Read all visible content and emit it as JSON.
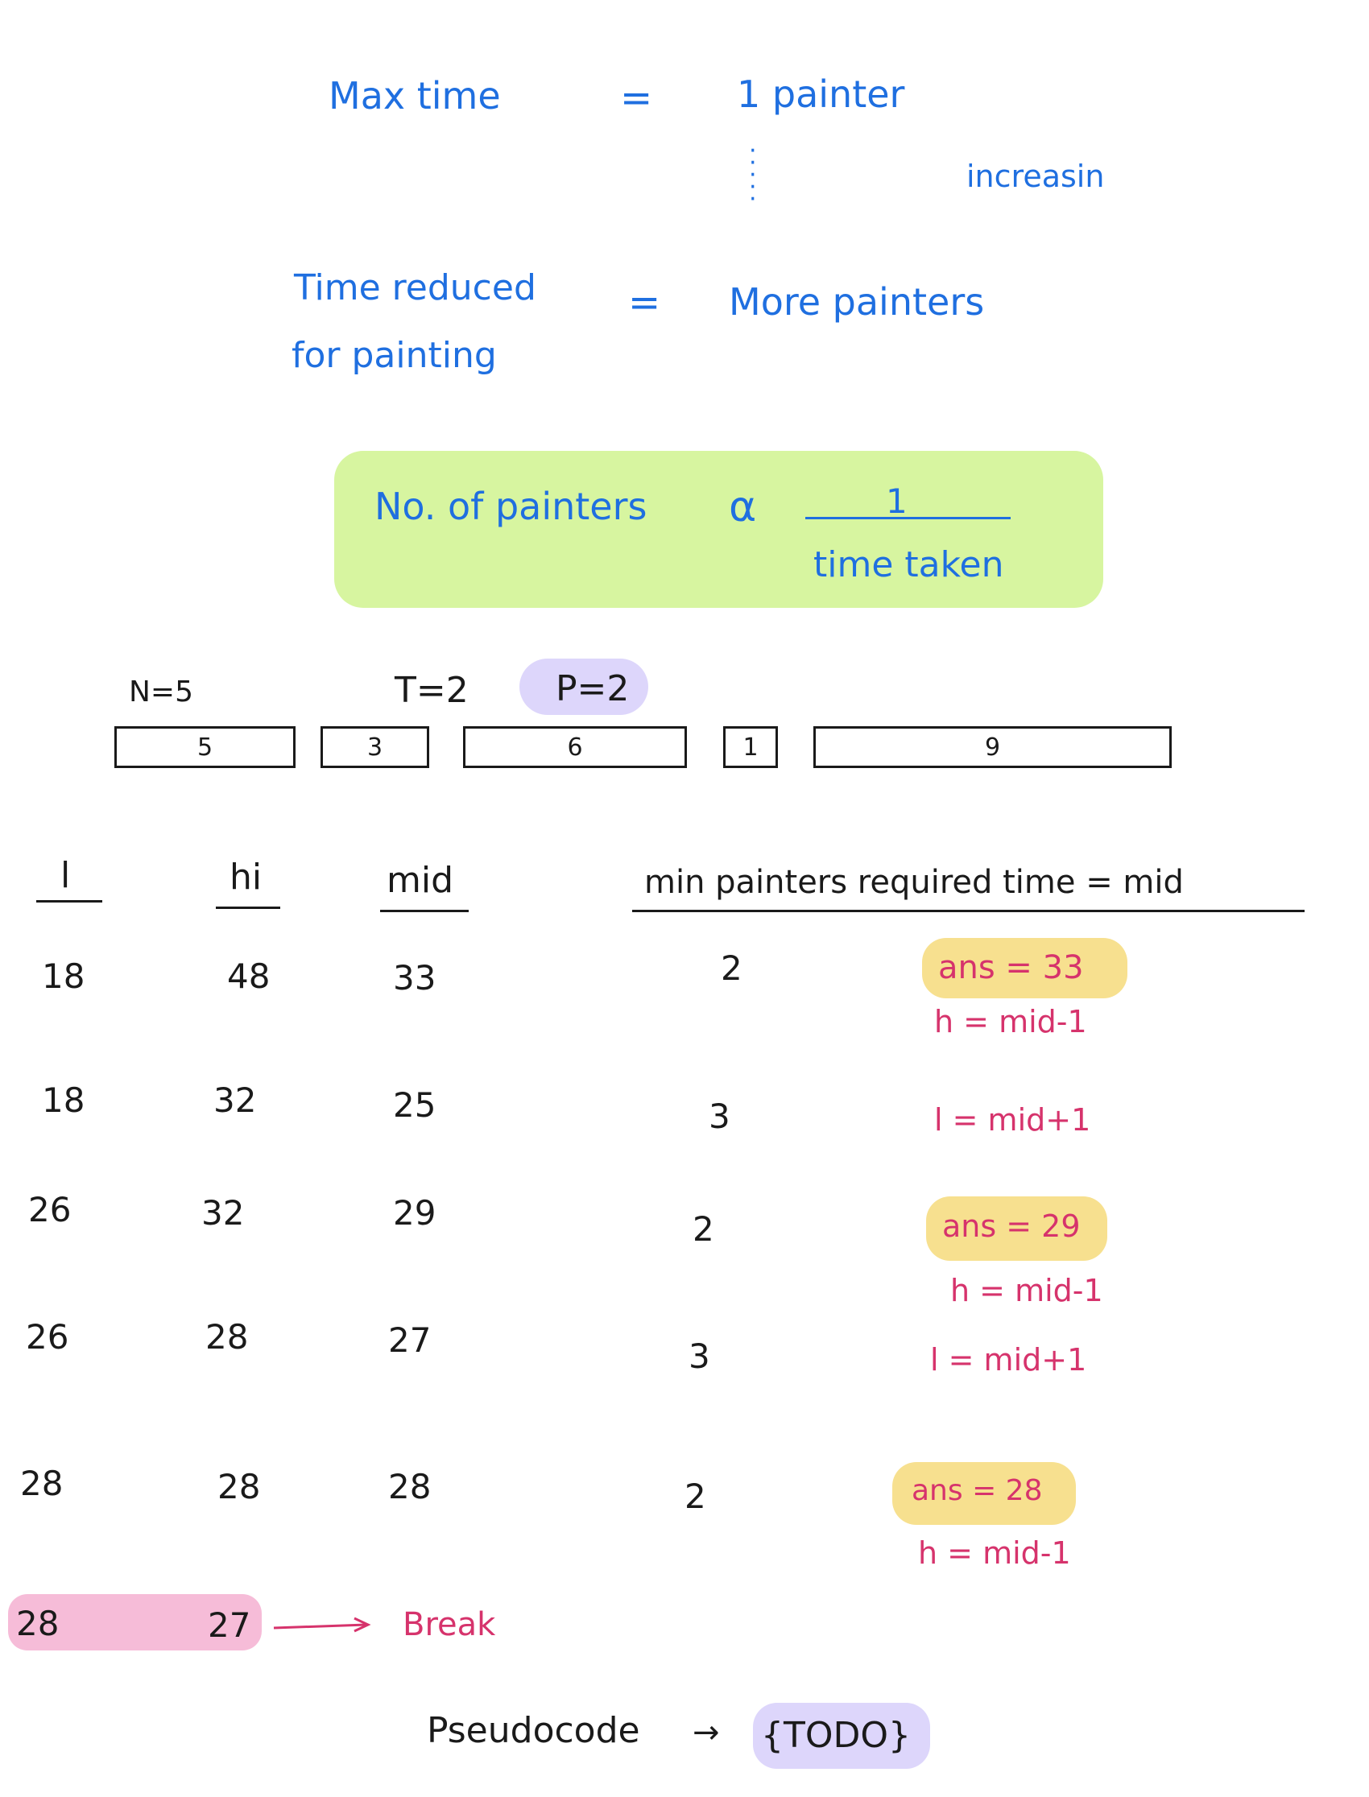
{
  "top": {
    "max_time": "Max time",
    "eq1": "=",
    "one_painter": "1 painter",
    "increasing": "increasin",
    "time_reduced": "Time reduced",
    "for_painting": "for painting",
    "eq2": "=",
    "more_painters": "More painters"
  },
  "formula": {
    "lhs": "No. of painters",
    "prop": "α",
    "numerator": "1",
    "denominator": "time taken"
  },
  "params": {
    "n": "N=5",
    "t": "T=2",
    "p": "P=2"
  },
  "boards": [
    "5",
    "3",
    "6",
    "1",
    "9"
  ],
  "table": {
    "headers": {
      "l": "l",
      "hi": "hi",
      "mid": "mid",
      "min_painters": "min painters required time = mid"
    },
    "rows": [
      {
        "l": "18",
        "hi": "48",
        "mid": "33",
        "p": "2",
        "note1": "ans = 33",
        "note2": "h = mid-1"
      },
      {
        "l": "18",
        "hi": "32",
        "mid": "25",
        "p": "3",
        "note1": "",
        "note2": "l = mid+1"
      },
      {
        "l": "26",
        "hi": "32",
        "mid": "29",
        "p": "2",
        "note1": "ans = 29",
        "note2": "h = mid-1"
      },
      {
        "l": "26",
        "hi": "28",
        "mid": "27",
        "p": "3",
        "note1": "",
        "note2": "l = mid+1"
      },
      {
        "l": "28",
        "hi": "28",
        "mid": "28",
        "p": "2",
        "note1": "ans = 28",
        "note2": "h = mid-1"
      }
    ],
    "final": {
      "l": "28",
      "hi": "27",
      "arrow": "→",
      "label": "Break"
    }
  },
  "pseudocode": {
    "label": "Pseudocode",
    "arrow": "→",
    "todo": "{TODO}"
  },
  "colors": {
    "ink_blue": "#1f6fe0",
    "ink_black": "#1a1a1a",
    "ink_pink": "#d6336c",
    "green_highlight": "#d7f5a0",
    "yellow_highlight": "#f7e08f",
    "purple_highlight": "#ddd6fb",
    "pink_highlight": "#f6bcd8"
  }
}
